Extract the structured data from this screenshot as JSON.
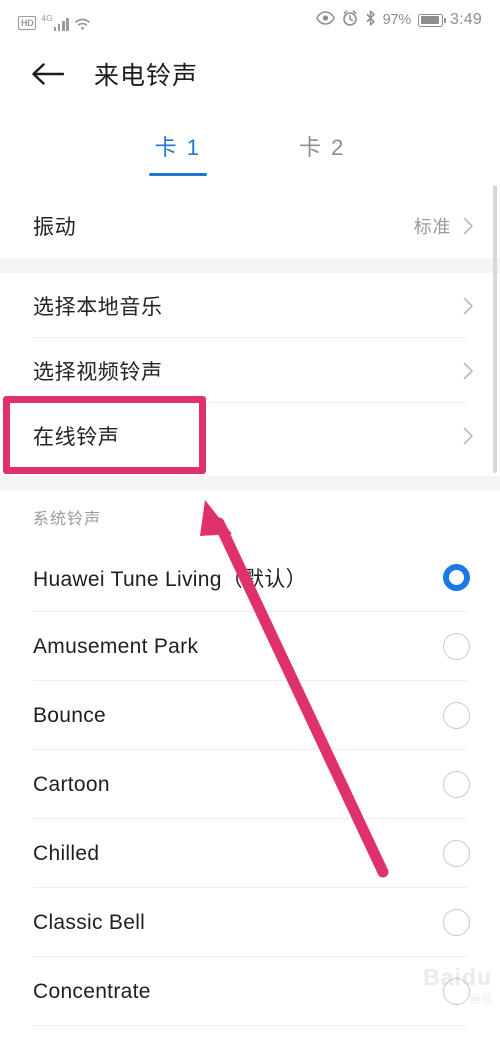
{
  "statusbar": {
    "hd_badge": "HD",
    "network_type": "4G",
    "icons": [
      "hd-icon",
      "signal-bars-icon",
      "wifi-icon",
      "eye-icon",
      "alarm-icon",
      "bluetooth-icon"
    ],
    "battery_percent": "97%",
    "time": "3:49"
  },
  "header": {
    "back_label": "back-arrow",
    "title": "来电铃声"
  },
  "tabs": [
    {
      "label": "卡 1",
      "active": true
    },
    {
      "label": "卡 2",
      "active": false
    }
  ],
  "settings_section_1": [
    {
      "label": "振动",
      "value": "标准",
      "chevron": true
    }
  ],
  "settings_section_2": [
    {
      "label": "选择本地音乐",
      "value": "",
      "chevron": true
    },
    {
      "label": "选择视频铃声",
      "value": "",
      "chevron": true
    },
    {
      "label": "在线铃声",
      "value": "",
      "chevron": true,
      "highlighted": true
    }
  ],
  "system_ringtones": {
    "header": "系统铃声",
    "items": [
      {
        "name": "Huawei Tune Living（默认）",
        "selected": true
      },
      {
        "name": "Amusement Park",
        "selected": false
      },
      {
        "name": "Bounce",
        "selected": false
      },
      {
        "name": "Cartoon",
        "selected": false
      },
      {
        "name": "Chilled",
        "selected": false
      },
      {
        "name": "Classic Bell",
        "selected": false
      },
      {
        "name": "Concentrate",
        "selected": false
      }
    ]
  },
  "annotation": {
    "highlight_color": "#e0316f",
    "arrow_color": "#e0316f",
    "target": "在线铃声"
  },
  "watermark": {
    "text": "Baidu",
    "sub": "经验"
  },
  "colors": {
    "accent_blue": "#2176d8",
    "radio_selected": "#1b78e4",
    "divider": "#eeeeee",
    "section_gap": "#f4f4f5",
    "annotation_pink": "#e0316f"
  }
}
